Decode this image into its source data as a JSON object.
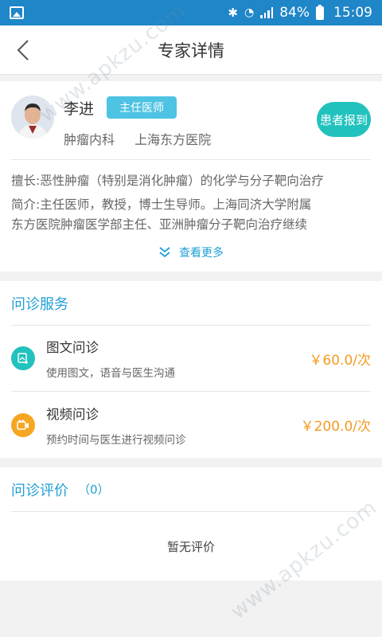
{
  "status_bar": {
    "battery": "84%",
    "time": "15:09"
  },
  "navbar": {
    "title": "专家详情"
  },
  "doctor": {
    "name": "李进",
    "title_badge": "主任医师",
    "department": "肿瘤内科",
    "hospital": "上海东方医院",
    "report_button": "患者报到",
    "specialty": "擅长:恶性肿瘤（特别是消化肿瘤）的化学与分子靶向治疗",
    "intro_line1": "简介:主任医师，教授，博士生导师。上海同济大学附属",
    "intro_line2": "东方医院肿瘤医学部主任、亚洲肿瘤分子靶向治疗继续",
    "see_more": "查看更多"
  },
  "services": {
    "title": "问诊服务",
    "items": [
      {
        "name": "图文问诊",
        "desc": "使用图文，语音与医生沟通",
        "price": "￥60.0/次",
        "icon": "image-chat-icon"
      },
      {
        "name": "视频问诊",
        "desc": "预约时间与医生进行视频问诊",
        "price": "￥200.0/次",
        "icon": "video-icon"
      }
    ]
  },
  "reviews": {
    "title": "问诊评价",
    "count": "（0）",
    "empty_text": "暂无评价"
  },
  "watermark": "www.apkzu.com",
  "colors": {
    "status_bar": "#1f86c8",
    "accent_blue": "#1f9fd6",
    "badge": "#4ec3e3",
    "teal": "#21c2bd",
    "orange": "#f6a623",
    "price": "#f39b1e"
  }
}
